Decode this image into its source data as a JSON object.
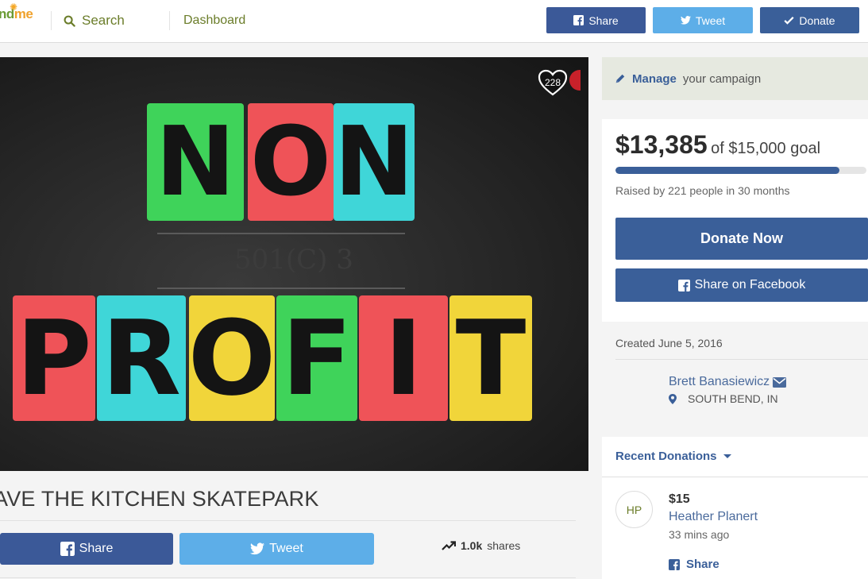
{
  "header": {
    "logo_text_a": "nd",
    "logo_text_b": "me",
    "search_label": "Search",
    "dashboard_label": "Dashboard",
    "share_label": "Share",
    "tweet_label": "Tweet",
    "donate_label": "Donate",
    "colors": {
      "facebook": "#3b5998",
      "twitter": "#5daee8",
      "donate": "#3a5f99"
    }
  },
  "hero": {
    "like_count": "228",
    "word_top": [
      "N",
      "O",
      "N"
    ],
    "subtitle": "501(C) 3",
    "word_bottom": [
      "P",
      "R",
      "O",
      "F",
      "I",
      "T"
    ]
  },
  "campaign": {
    "title": "AVE THE KITCHEN SKATEPARK",
    "share_label": "Share",
    "tweet_label": "Tweet",
    "shares_count": "1.0k",
    "shares_label": "shares"
  },
  "sidebar": {
    "manage_strong": "Manage",
    "manage_rest": "your campaign",
    "raised_amount": "$13,385",
    "goal_text": "of $15,000 goal",
    "progress_fraction": 0.892,
    "raised_by": "Raised by 221 people in 30 months",
    "donate_now": "Donate Now",
    "share_facebook": "Share on Facebook",
    "created": "Created June 5, 2016",
    "organizer": "Brett Banasiewicz",
    "location": "SOUTH BEND, IN",
    "recent_heading": "Recent Donations",
    "recent": [
      {
        "initials": "HP",
        "amount": "$15",
        "name": "Heather Planert",
        "time": "33 mins ago",
        "share": "Share"
      }
    ]
  }
}
